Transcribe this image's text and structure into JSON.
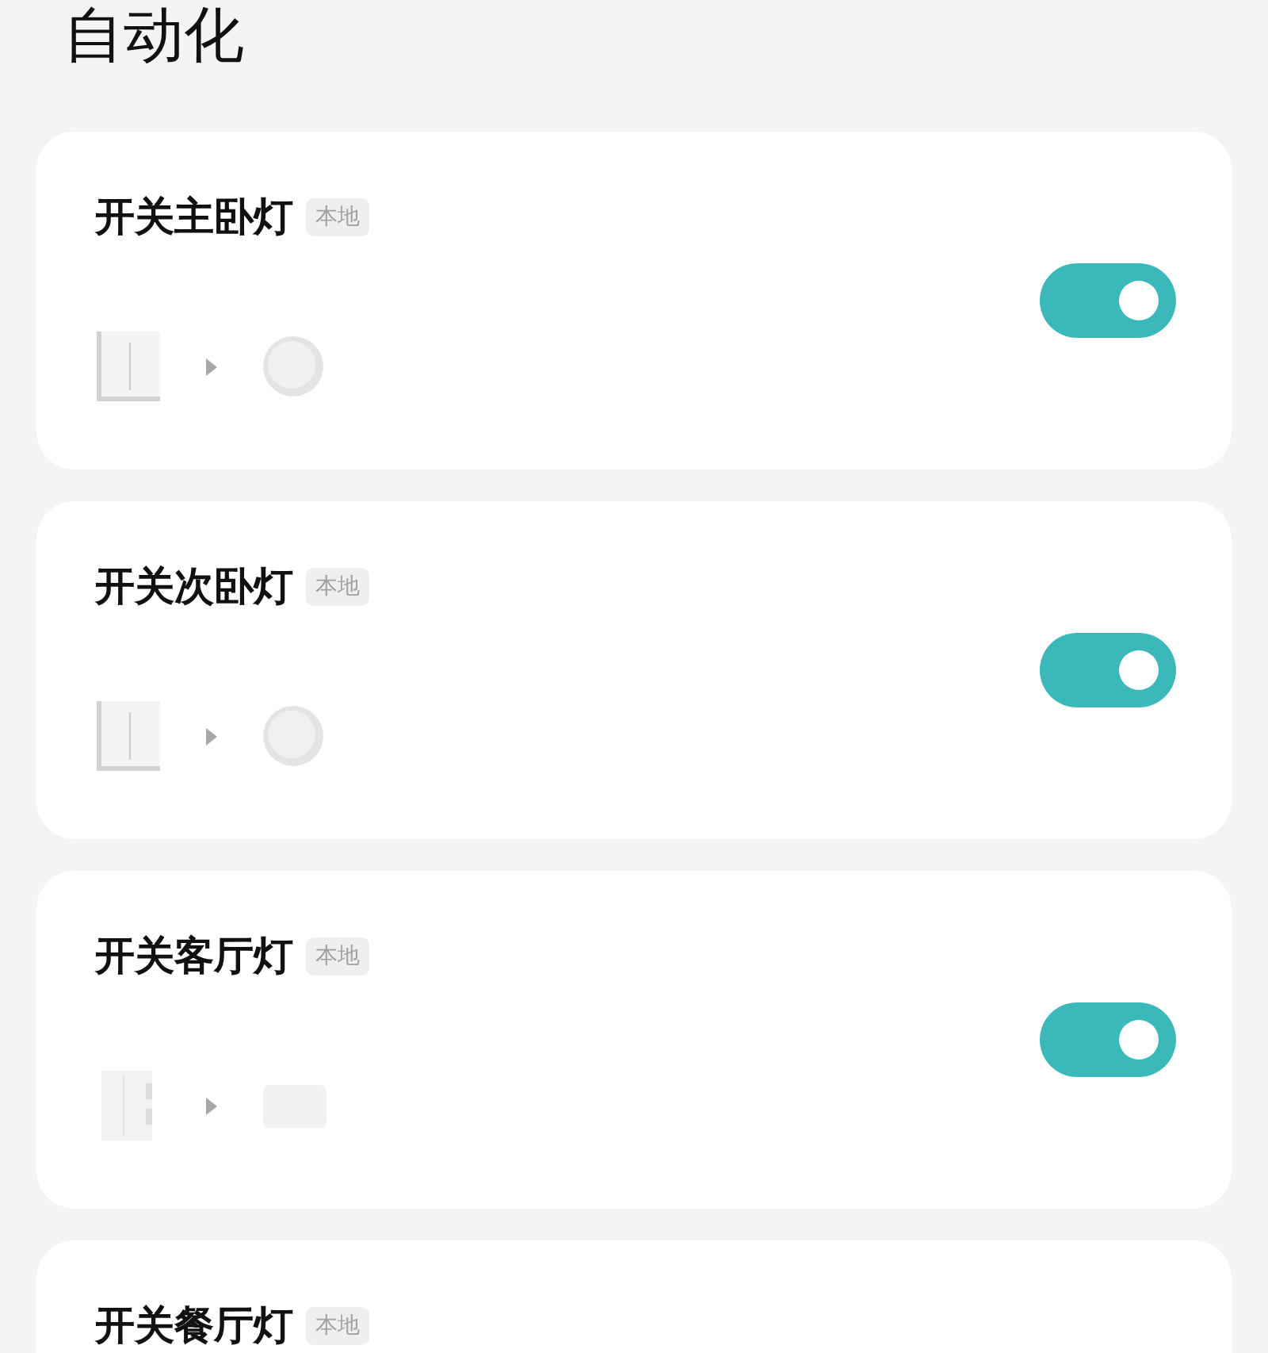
{
  "page_title": "自动化",
  "automations": [
    {
      "title": "开关主卧灯",
      "tag": "本地",
      "enabled": true,
      "devices": [
        {
          "kind": "double-switch"
        },
        {
          "kind": "round-light"
        }
      ]
    },
    {
      "title": "开关次卧灯",
      "tag": "本地",
      "enabled": true,
      "devices": [
        {
          "kind": "double-switch"
        },
        {
          "kind": "round-light"
        }
      ]
    },
    {
      "title": "开关客厅灯",
      "tag": "本地",
      "enabled": true,
      "devices": [
        {
          "kind": "triple-switch"
        },
        {
          "kind": "panel-light"
        }
      ]
    },
    {
      "title": "开关餐厅灯",
      "tag": "本地"
    }
  ]
}
